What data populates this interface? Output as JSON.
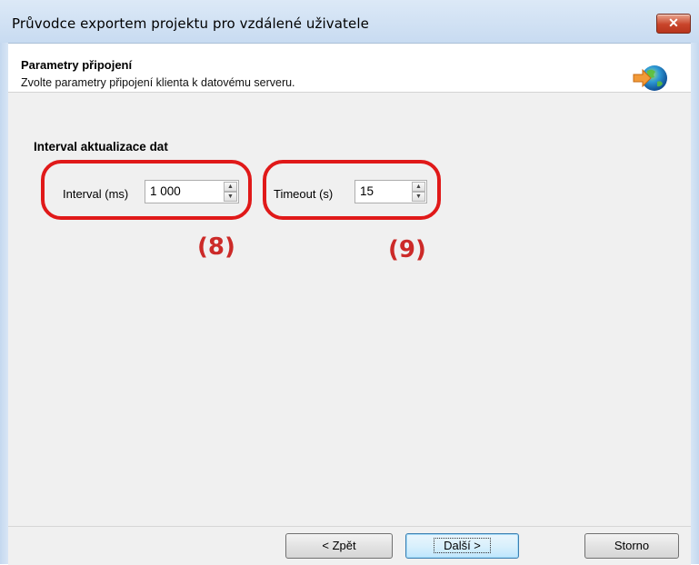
{
  "window": {
    "title": "Průvodce exportem projektu pro vzdálené uživatele",
    "close_label": "✕"
  },
  "header": {
    "title": "Parametry připojení",
    "subtitle": "Zvolte parametry připojení klienta k datovému serveru.",
    "icon": "globe-arrow-icon"
  },
  "section": {
    "title": "Interval aktualizace dat",
    "interval": {
      "label": "Interval (ms)",
      "value": "1 000"
    },
    "timeout": {
      "label": "Timeout (s)",
      "value": "15"
    }
  },
  "annotations": {
    "interval_callout": "(8)",
    "timeout_callout": "(9)",
    "color": "#e01919"
  },
  "footer": {
    "back_label": "< Zpět",
    "next_label": "Další >",
    "cancel_label": "Storno"
  },
  "colors": {
    "titlebar": "#c8dbf1",
    "close": "#c8442a",
    "content_bg": "#f0f0f0",
    "default_button_border": "#3c7fb1"
  }
}
